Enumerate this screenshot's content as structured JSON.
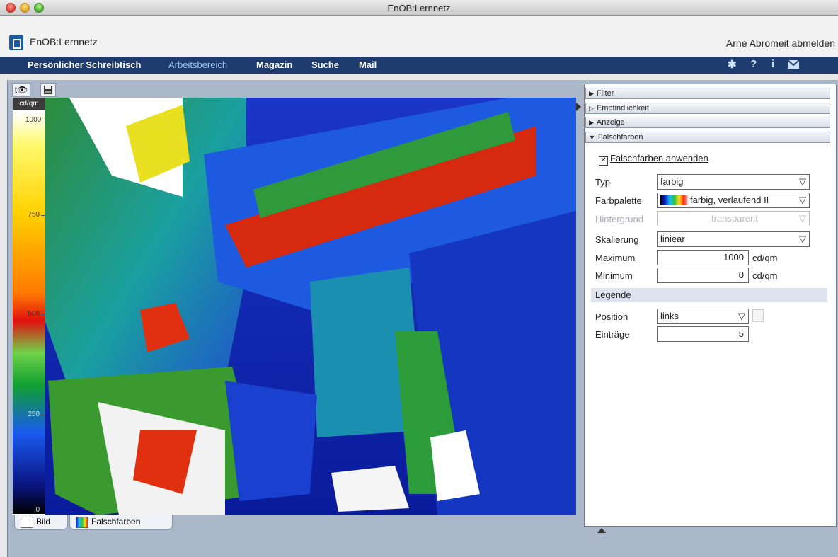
{
  "window": {
    "title": "EnOB:Lernnetz"
  },
  "app": {
    "name": "EnOB:Lernnetz",
    "logout": "Arne Abromeit abmelden"
  },
  "nav": {
    "items": [
      "Persönlicher Schreibtisch",
      "Arbeitsbereich",
      "Magazin",
      "Suche",
      "Mail"
    ],
    "active": "Arbeitsbereich",
    "icons": [
      "gear-icon",
      "help-icon",
      "info-icon",
      "mail-icon"
    ],
    "icon_glyphs": {
      "help": "?",
      "info": "i"
    }
  },
  "viewer": {
    "legend": {
      "unit": "cd/qm",
      "labels": [
        "1000",
        "750",
        "500",
        "250",
        "0"
      ]
    },
    "tabs": [
      "Bild",
      "Falschfarben"
    ],
    "active_tab": "Falschfarben"
  },
  "panel": {
    "sections": [
      {
        "label": "Filter",
        "expanded": false
      },
      {
        "label": "Empfindlichkeit",
        "expanded": false
      },
      {
        "label": "Anzeige",
        "expanded": false
      },
      {
        "label": "Falschfarben",
        "expanded": true
      }
    ],
    "apply_label": "Falschfarben anwenden",
    "apply_checked": true,
    "fields": {
      "typ": {
        "label": "Typ",
        "value": "farbig"
      },
      "farbpalette": {
        "label": "Farbpalette",
        "value": "farbig, verlaufend II"
      },
      "hintergrund": {
        "label": "Hintergrund",
        "value": "transparent",
        "disabled": true
      },
      "skalierung": {
        "label": "Skalierung",
        "value": "liniear"
      },
      "maximum": {
        "label": "Maximum",
        "value": "1000",
        "unit": "cd/qm"
      },
      "minimum": {
        "label": "Minimum",
        "value": "0",
        "unit": "cd/qm"
      }
    },
    "legend_section": {
      "title": "Legende",
      "position": {
        "label": "Position",
        "value": "links"
      },
      "eintraege": {
        "label": "Einträge",
        "value": "5"
      }
    }
  },
  "colors": {
    "nav_bg": "#1e3b6e",
    "accent": "#1d5a9e"
  }
}
